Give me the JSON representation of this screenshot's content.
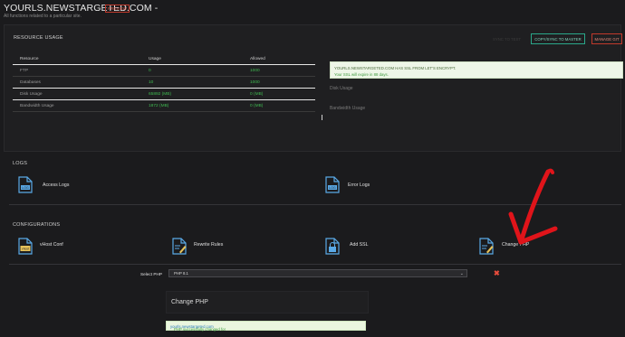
{
  "header": {
    "title": "YOURLS.NEWSTARGETED.COM -",
    "preview": "PREVIEW",
    "subtitle": "All functions related to a particular site."
  },
  "resource_usage": {
    "label": "RESOURCE USAGE",
    "sync_disabled": "SYNC TO TEST",
    "copy_button": "COPY/SYNC TO MASTER",
    "manage_button": "MANAGE GIT",
    "columns": [
      "Resource",
      "Usage",
      "Allowed"
    ],
    "rows": [
      {
        "resource": "FTP",
        "usage": "0",
        "allowed": "1000"
      },
      {
        "resource": "Databases",
        "usage": "10",
        "allowed": "1000"
      },
      {
        "resource": "Disk Usage",
        "usage": "65892 (MB)",
        "allowed": "0 (MB)"
      },
      {
        "resource": "Bandwidth Usage",
        "usage": "1872 (MB)",
        "allowed": "0 (MB)"
      }
    ],
    "ssl": {
      "title": "YOURLS.NEWSTARGETED.COM HAS SSL FROM LET'S ENCRYPT.",
      "message": "Your SSL will expire in 88 days."
    },
    "disk_label": "Disk Usage",
    "bandwidth_label": "Bandwidth Usage"
  },
  "logs": {
    "label": "LOGS",
    "items": [
      {
        "label": "Access Logs",
        "icon": "log-file-icon"
      },
      {
        "label": "Error Logs",
        "icon": "log-file-icon"
      }
    ]
  },
  "configurations": {
    "label": "CONFIGURATIONS",
    "items": [
      {
        "label": "vHost Conf",
        "icon": "vhost-icon"
      },
      {
        "label": "Rewrite Rules",
        "icon": "rewrite-icon"
      },
      {
        "label": "Add SSL",
        "icon": "ssl-icon"
      },
      {
        "label": "Change PHP",
        "icon": "php-icon"
      }
    ]
  },
  "php": {
    "select_label": "Select PHP",
    "selected_value": "PHP 8.1",
    "change_button": "Change PHP",
    "success_prefix": "PHP successfully changed for ",
    "success_site": "yourls.newstargeted.com"
  },
  "colors": {
    "background": "#1b1b1d",
    "success_green": "#3fb950",
    "accent_teal": "#2aa88a",
    "danger_red": "#c0392b",
    "annotation_arrow": "#e0141a"
  }
}
